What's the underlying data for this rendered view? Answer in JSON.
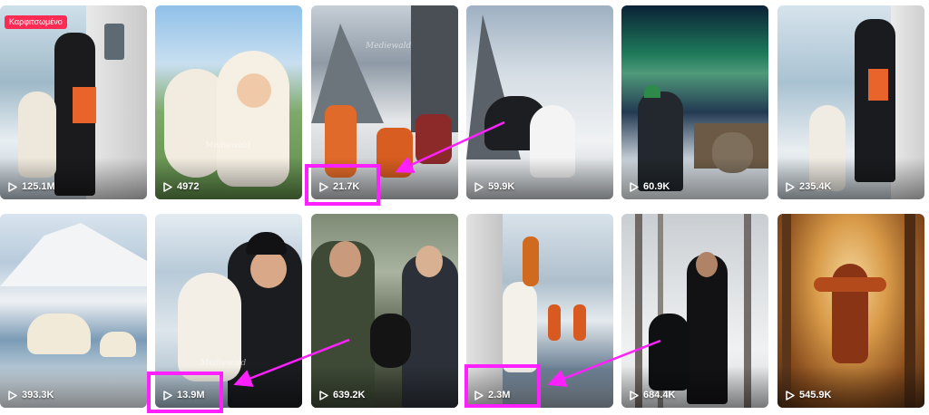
{
  "videos": [
    {
      "views": "125.1M",
      "pinned_label": "Καρφιτσωμένο"
    },
    {
      "views": "4972"
    },
    {
      "views": "21.7K"
    },
    {
      "views": "59.9K"
    },
    {
      "views": "60.9K"
    },
    {
      "views": "235.4K"
    },
    {
      "views": "393.3K"
    },
    {
      "views": "13.9M"
    },
    {
      "views": "639.2K"
    },
    {
      "views": "2.3M"
    },
    {
      "views": "684.4K"
    },
    {
      "views": "545.9K"
    }
  ],
  "watermark": "Mediewald",
  "icons": {
    "play": "play-icon"
  },
  "colors": {
    "highlight": "#ff20ff",
    "pin_badge": "#fe2c55"
  }
}
